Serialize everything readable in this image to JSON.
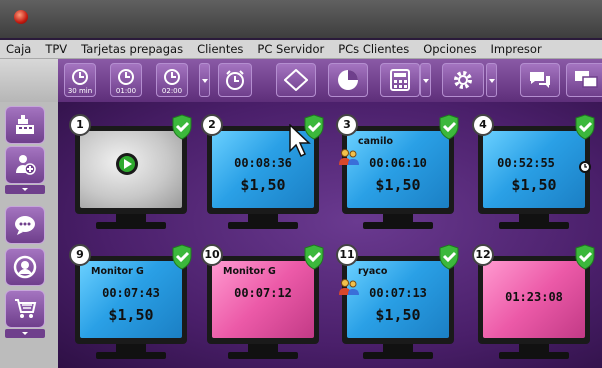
{
  "menu": [
    "Caja",
    "TPV",
    "Tarjetas prepagas",
    "Clientes",
    "PC Servidor",
    "PCs Clientes",
    "Opciones",
    "Impresor"
  ],
  "toolbar": {
    "timers": [
      {
        "label": "30 min",
        "icon": "clock-icon"
      },
      {
        "label": "01:00",
        "icon": "clock-icon"
      },
      {
        "label": "02:00",
        "icon": "clock-icon"
      }
    ],
    "icons": [
      "alarm-clock-icon",
      "ticket-icon",
      "pie-chart-icon",
      "calculator-icon",
      "gear-icon",
      "chat-icon",
      "monitors-icon"
    ]
  },
  "sidebar": [
    "cash-register-icon",
    "add-user-icon",
    "chat-icon",
    "headset-icon",
    "shopping-cart-icon"
  ],
  "workstations": [
    {
      "number": "1",
      "status": "off",
      "user": "",
      "time": "",
      "price": ""
    },
    {
      "number": "2",
      "status": "active",
      "user": "",
      "time": "00:08:36",
      "price": "$1,50"
    },
    {
      "number": "3",
      "status": "active",
      "user": "camilo",
      "time": "00:06:10",
      "price": "$1,50"
    },
    {
      "number": "4",
      "status": "active",
      "user": "",
      "time": "00:52:55",
      "price": "$1,50"
    },
    {
      "number": "9",
      "status": "active",
      "user": "Monitor G",
      "time": "00:07:43",
      "price": "$1,50"
    },
    {
      "number": "10",
      "status": "pink",
      "user": "Monitor G",
      "time": "00:07:12",
      "price": ""
    },
    {
      "number": "11",
      "status": "active",
      "user": "ryaco",
      "time": "00:07:13",
      "price": "$1,50"
    },
    {
      "number": "12",
      "status": "pink",
      "user": "",
      "time": "01:23:08",
      "price": ""
    }
  ],
  "colors": {
    "accent": "#6f3f8c",
    "active_screen": "#2aa0e6",
    "limited_screen": "#ec5aa8",
    "shield": "#3cb83c"
  }
}
